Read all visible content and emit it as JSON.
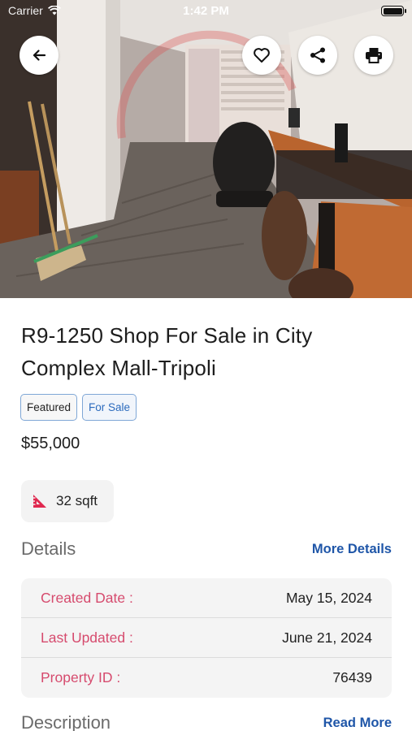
{
  "status_bar": {
    "carrier": "Carrier",
    "time": "1:42 PM"
  },
  "nav": {
    "back_icon": "arrow-left-icon",
    "favorite_icon": "heart-icon",
    "share_icon": "share-icon",
    "print_icon": "printer-icon"
  },
  "listing": {
    "title": "R9-1250 Shop For Sale in City Complex Mall-Tripoli",
    "badges": [
      "Featured",
      "For Sale"
    ],
    "price": "$55,000",
    "area": "32 sqft",
    "area_icon": "ruler-triangle-icon"
  },
  "details": {
    "heading": "Details",
    "more_link": "More Details",
    "rows": [
      {
        "label": "Created Date :",
        "value": "May 15, 2024"
      },
      {
        "label": "Last Updated :",
        "value": "June 21, 2024"
      },
      {
        "label": "Property ID :",
        "value": "76439"
      }
    ]
  },
  "description": {
    "heading": "Description",
    "read_more": "Read More"
  },
  "colors": {
    "accent_blue": "#1f56a8",
    "label_red": "#d64b6e",
    "area_icon": "#e0284f"
  }
}
